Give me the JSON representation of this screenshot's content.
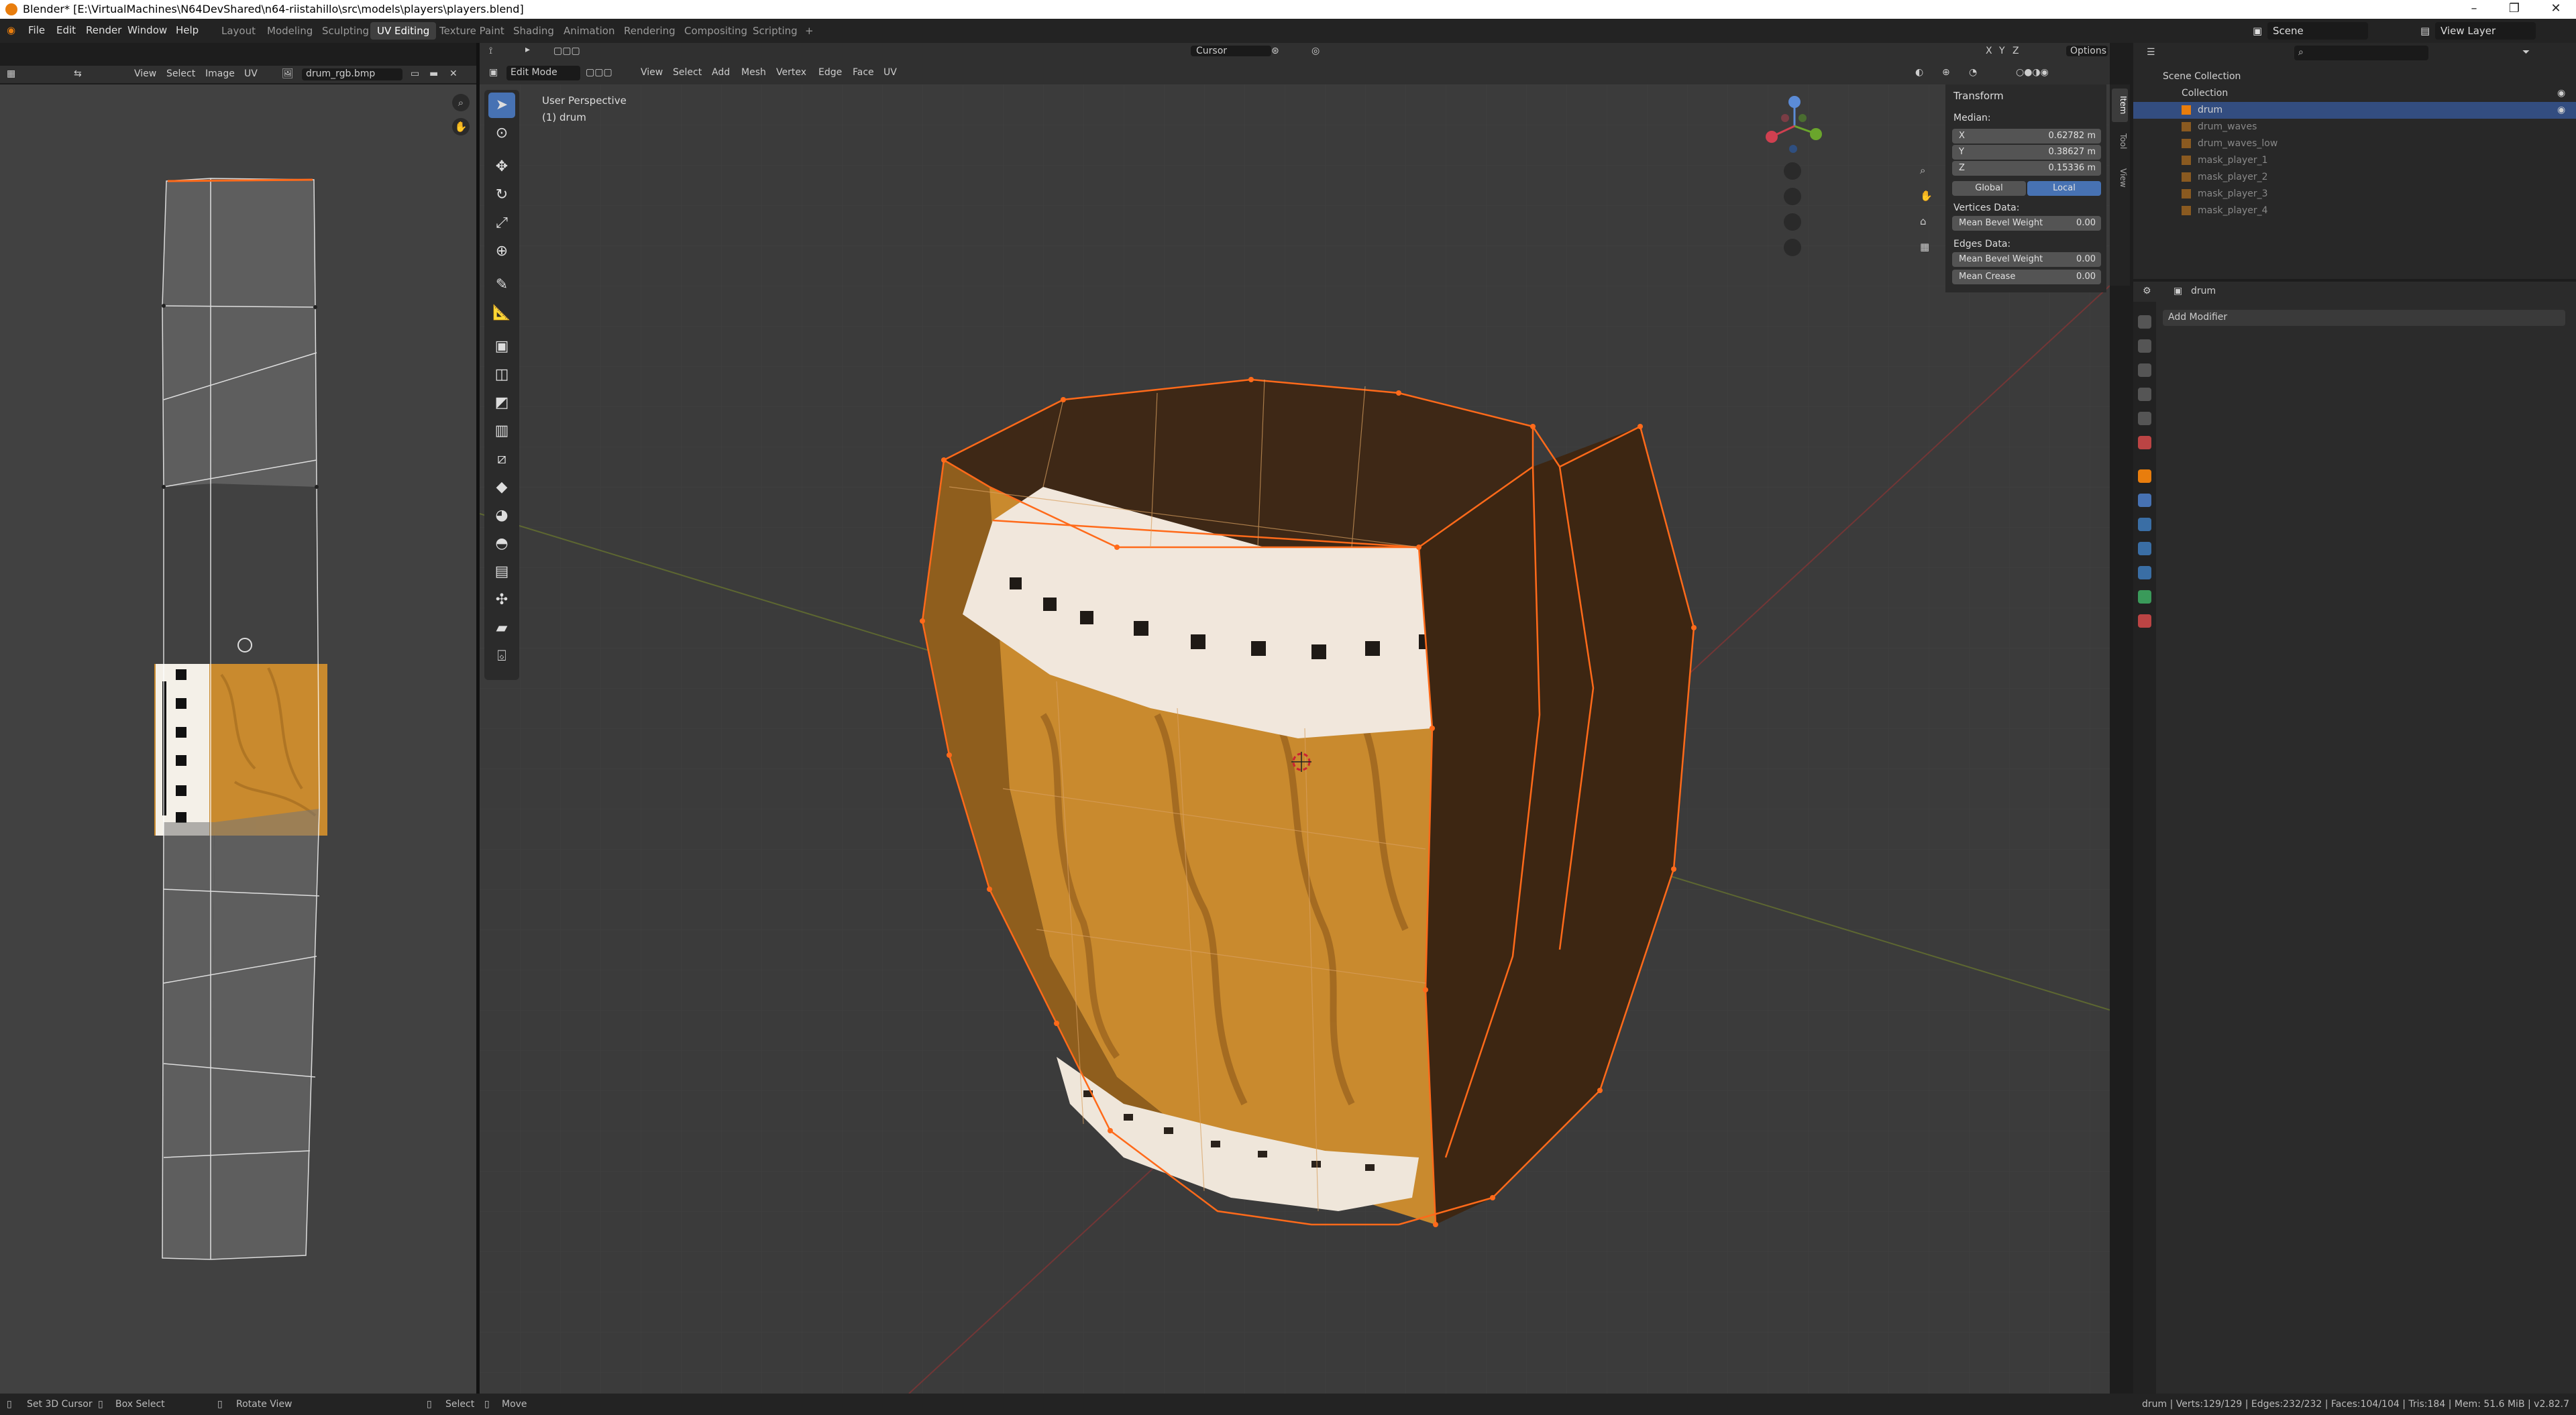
{
  "titlebar": {
    "title": "Blender* [E:\\VirtualMachines\\N64DevShared\\n64-riistahillo\\src\\models\\players\\players.blend]"
  },
  "menu": [
    "File",
    "Edit",
    "Render",
    "Window",
    "Help"
  ],
  "workspaces": [
    "Layout",
    "Modeling",
    "Sculpting",
    "UV Editing",
    "Texture Paint",
    "Shading",
    "Animation",
    "Rendering",
    "Compositing",
    "Scripting",
    "+"
  ],
  "top_right": {
    "scene": "Scene",
    "view_layer": "View Layer"
  },
  "uv_editor": {
    "menus": [
      "View",
      "Select",
      "Image",
      "UV"
    ],
    "image_name": "drum_rgb.bmp"
  },
  "viewport": {
    "mode": "Edit Mode",
    "menus": [
      "View",
      "Select",
      "Add",
      "Mesh",
      "Vertex",
      "Edge",
      "Face",
      "UV"
    ],
    "pivot": "Cursor",
    "axes": [
      "X",
      "Y",
      "Z"
    ],
    "options": "Options",
    "perspective": "User Perspective",
    "object": "(1) drum"
  },
  "npanel": {
    "title": "Transform",
    "median_label": "Median:",
    "x": {
      "label": "X",
      "value": "0.62782 m"
    },
    "y": {
      "label": "Y",
      "value": "0.38627 m"
    },
    "z": {
      "label": "Z",
      "value": "0.15336 m"
    },
    "global": "Global",
    "local": "Local",
    "vertices_data": "Vertices Data:",
    "mean_bevel_v": {
      "label": "Mean Bevel Weight",
      "value": "0.00"
    },
    "edges_data": "Edges Data:",
    "mean_bevel_e": {
      "label": "Mean Bevel Weight",
      "value": "0.00"
    },
    "mean_crease": {
      "label": "Mean Crease",
      "value": "0.00"
    },
    "tabs": [
      "Item",
      "Tool",
      "View"
    ]
  },
  "outliner": {
    "scene_collection": "Scene Collection",
    "collection": "Collection",
    "items": [
      "drum",
      "drum_waves",
      "drum_waves_low",
      "mask_player_1",
      "mask_player_2",
      "mask_player_3",
      "mask_player_4"
    ]
  },
  "properties": {
    "object": "drum",
    "add_modifier": "Add Modifier"
  },
  "status": {
    "set_cursor": "Set 3D Cursor",
    "box_select": "Box Select",
    "rotate_view": "Rotate View",
    "select": "Select",
    "move": "Move",
    "stats": "drum | Verts:129/129 | Edges:232/232 | Faces:104/104 | Tris:184 | Mem: 51.6 MiB | v2.82.7"
  },
  "colors": {
    "accent": "#4772b3",
    "selection_edge": "#ff6a1a",
    "wood": "#c98a2e",
    "top_dark": "#3c2614"
  }
}
